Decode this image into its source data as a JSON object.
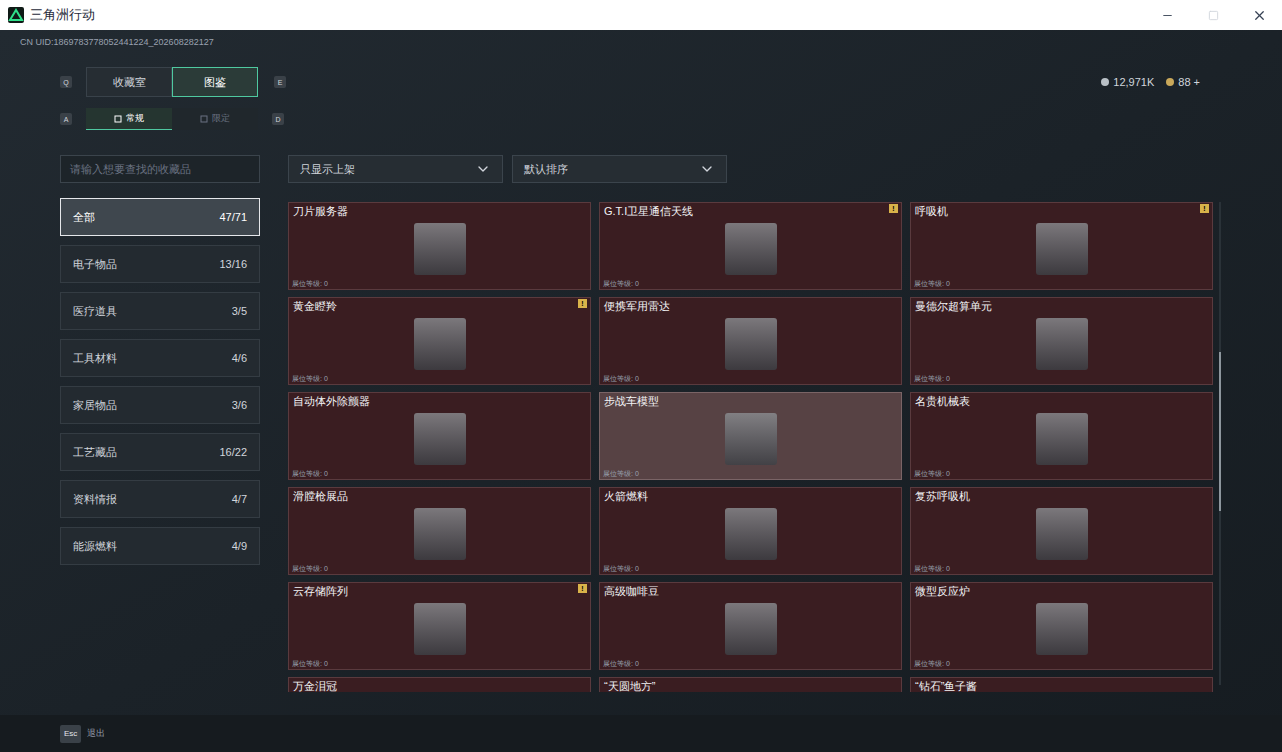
{
  "window": {
    "title": "三角洲行动"
  },
  "uid": "CN UID:1869783778052441224_202608282127",
  "currency": [
    {
      "value": "12,971K",
      "color": "#b9c0c6"
    },
    {
      "value": "88 +",
      "color": "#c9a85a"
    }
  ],
  "top_tabs": {
    "prev_key": "Q",
    "next_key": "E",
    "tabs": [
      {
        "label": "收藏室",
        "selected": false
      },
      {
        "label": "图鉴",
        "selected": true
      }
    ]
  },
  "sub_tabs": {
    "prev_key": "A",
    "next_key": "D",
    "tabs": [
      {
        "label": "常规",
        "selected": true
      },
      {
        "label": "限定",
        "selected": false
      }
    ]
  },
  "search": {
    "placeholder": "请输入想要查找的收藏品"
  },
  "categories": [
    {
      "label": "全部",
      "count": "47/71",
      "selected": true
    },
    {
      "label": "电子物品",
      "count": "13/16",
      "selected": false
    },
    {
      "label": "医疗道具",
      "count": "3/5",
      "selected": false
    },
    {
      "label": "工具材料",
      "count": "4/6",
      "selected": false
    },
    {
      "label": "家居物品",
      "count": "3/6",
      "selected": false
    },
    {
      "label": "工艺藏品",
      "count": "16/22",
      "selected": false
    },
    {
      "label": "资料情报",
      "count": "4/7",
      "selected": false
    },
    {
      "label": "能源燃料",
      "count": "4/9",
      "selected": false
    }
  ],
  "filters": [
    {
      "label": "只显示上架"
    },
    {
      "label": "默认排序"
    }
  ],
  "alert_mark": "!",
  "items": [
    {
      "name": "刀片服务器",
      "level_text": "展位等级: 0",
      "alert": false,
      "highlighted": false
    },
    {
      "name": "G.T.I卫星通信天线",
      "level_text": "展位等级: 0",
      "alert": true,
      "highlighted": false
    },
    {
      "name": "呼吸机",
      "level_text": "展位等级: 0",
      "alert": true,
      "highlighted": false
    },
    {
      "name": "黄金瞪羚",
      "level_text": "展位等级: 0",
      "alert": true,
      "highlighted": false
    },
    {
      "name": "便携军用雷达",
      "level_text": "展位等级: 0",
      "alert": false,
      "highlighted": false
    },
    {
      "name": "曼德尔超算单元",
      "level_text": "展位等级: 0",
      "alert": false,
      "highlighted": false
    },
    {
      "name": "自动体外除颤器",
      "level_text": "展位等级: 0",
      "alert": false,
      "highlighted": false
    },
    {
      "name": "步战车模型",
      "level_text": "展位等级: 0",
      "alert": false,
      "highlighted": true
    },
    {
      "name": "名贵机械表",
      "level_text": "展位等级: 0",
      "alert": false,
      "highlighted": false
    },
    {
      "name": "滑膛枪展品",
      "level_text": "展位等级: 0",
      "alert": false,
      "highlighted": false
    },
    {
      "name": "火箭燃料",
      "level_text": "展位等级: 0",
      "alert": false,
      "highlighted": false
    },
    {
      "name": "复苏呼吸机",
      "level_text": "展位等级: 0",
      "alert": false,
      "highlighted": false
    },
    {
      "name": "云存储阵列",
      "level_text": "展位等级: 0",
      "alert": true,
      "highlighted": false
    },
    {
      "name": "高级咖啡豆",
      "level_text": "展位等级: 0",
      "alert": false,
      "highlighted": false
    },
    {
      "name": "微型反应炉",
      "level_text": "展位等级: 0",
      "alert": false,
      "highlighted": false
    },
    {
      "name": "万金泪冠",
      "alert": false,
      "highlighted": false
    },
    {
      "name": "“天圆地方”",
      "alert": false,
      "highlighted": false
    },
    {
      "name": "“钻石”鱼子酱",
      "alert": false,
      "highlighted": false
    }
  ],
  "scrollbar": {
    "position": 0.31,
    "size": 0.33
  },
  "footer": {
    "key": "Esc",
    "label": "退出"
  }
}
